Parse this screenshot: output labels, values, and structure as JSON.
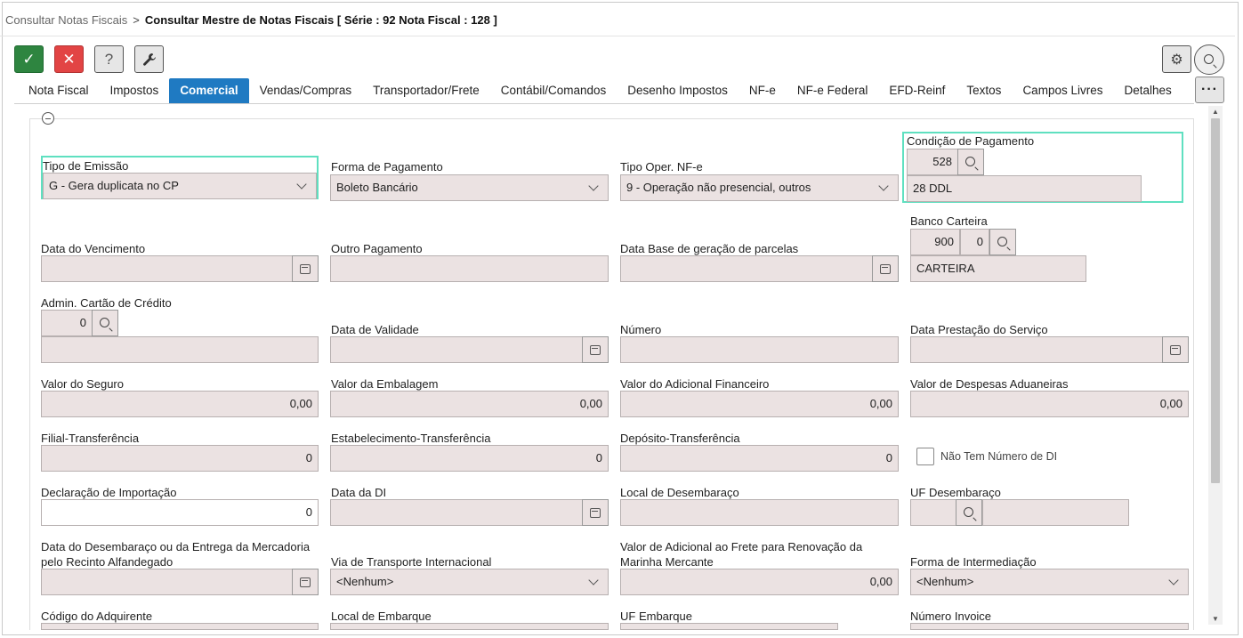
{
  "breadcrumb": {
    "parent": "Consultar Notas Fiscais",
    "separator": ">",
    "current": "Consultar Mestre de Notas Fiscais [ Série : 92 Nota Fiscal : 128 ]"
  },
  "toolbar": {
    "confirm_icon": "check-icon",
    "cancel_icon": "close-icon",
    "help_icon": "question-icon",
    "tools_icon": "wrench-icon",
    "settings_icon": "gear-icon",
    "search_icon": "search-icon",
    "confirm_glyph": "✓",
    "cancel_glyph": "✕",
    "help_glyph": "?",
    "tools_glyph": "🔧",
    "settings_glyph": "⚙",
    "more_glyph": "···"
  },
  "tabs": [
    "Nota Fiscal",
    "Impostos",
    "Comercial",
    "Vendas/Compras",
    "Transportador/Frete",
    "Contábil/Comandos",
    "Desenho Impostos",
    "NF-e",
    "NF-e Federal",
    "EFD-Reinf",
    "Textos",
    "Campos Livres",
    "Detalhes"
  ],
  "active_tab": "Comercial",
  "colors": {
    "accent": "#1f7ac2",
    "field_bg": "#ebe2e2",
    "focus": "#5fe0c0",
    "ok": "#2e8540",
    "cancel": "#e24444"
  },
  "form": {
    "tipo_emissao": {
      "label": "Tipo de Emissão",
      "value": "G - Gera duplicata no CP"
    },
    "forma_pagamento": {
      "label": "Forma de Pagamento",
      "value": "Boleto Bancário"
    },
    "tipo_oper_nfe": {
      "label": "Tipo Oper. NF-e",
      "value": "9 - Operação não presencial, outros"
    },
    "condicao_pagamento": {
      "label": "Condição de Pagamento",
      "code": "528",
      "description": "28 DDL"
    },
    "banco_carteira": {
      "label": "Banco Carteira",
      "bank": "900",
      "wallet": "0",
      "description": "CARTEIRA"
    },
    "data_vencimento": {
      "label": "Data do Vencimento",
      "value": ""
    },
    "outro_pagamento": {
      "label": "Outro Pagamento",
      "value": ""
    },
    "data_base_parcelas": {
      "label": "Data Base de geração de parcelas",
      "value": ""
    },
    "admin_cartao": {
      "label": "Admin. Cartão de Crédito",
      "code": "0",
      "description": ""
    },
    "data_validade": {
      "label": "Data de Validade",
      "value": ""
    },
    "numero": {
      "label": "Número",
      "value": ""
    },
    "data_prestacao": {
      "label": "Data Prestação do Serviço",
      "value": ""
    },
    "valor_seguro": {
      "label": "Valor do Seguro",
      "value": "0,00"
    },
    "valor_embalagem": {
      "label": "Valor da Embalagem",
      "value": "0,00"
    },
    "valor_adicional_financeiro": {
      "label": "Valor do Adicional Financeiro",
      "value": "0,00"
    },
    "valor_despesas_aduaneiras": {
      "label": "Valor de Despesas Aduaneiras",
      "value": "0,00"
    },
    "filial_transferencia": {
      "label": "Filial-Transferência",
      "value": "0"
    },
    "estabelecimento_transferencia": {
      "label": "Estabelecimento-Transferência",
      "value": "0"
    },
    "deposito_transferencia": {
      "label": "Depósito-Transferência",
      "value": "0"
    },
    "nao_tem_numero_di": {
      "label": "Não Tem Número de DI",
      "checked": false
    },
    "declaracao_importacao": {
      "label": "Declaração de Importação",
      "value": "0"
    },
    "data_di": {
      "label": "Data da DI",
      "value": ""
    },
    "local_desembaraco": {
      "label": "Local de Desembaraço",
      "value": ""
    },
    "uf_desembaraco": {
      "label": "UF Desembaraço",
      "code": "",
      "description": ""
    },
    "data_desembaraco": {
      "label": "Data do Desembaraço ou da Entrega da Mercadoria pelo Recinto Alfandegado",
      "value": ""
    },
    "via_transporte": {
      "label": "Via de Transporte Internacional",
      "value": "<Nenhum>"
    },
    "valor_frete_marinha": {
      "label": "Valor de Adicional ao Frete para Renovação da Marinha Mercante",
      "value": "0,00"
    },
    "forma_intermediacao": {
      "label": "Forma de Intermediação",
      "value": "<Nenhum>"
    },
    "codigo_adquirente": {
      "label": "Código do Adquirente"
    },
    "local_embarque": {
      "label": "Local de Embarque"
    },
    "uf_embarque": {
      "label": "UF Embarque"
    },
    "numero_invoice": {
      "label": "Número Invoice"
    }
  }
}
